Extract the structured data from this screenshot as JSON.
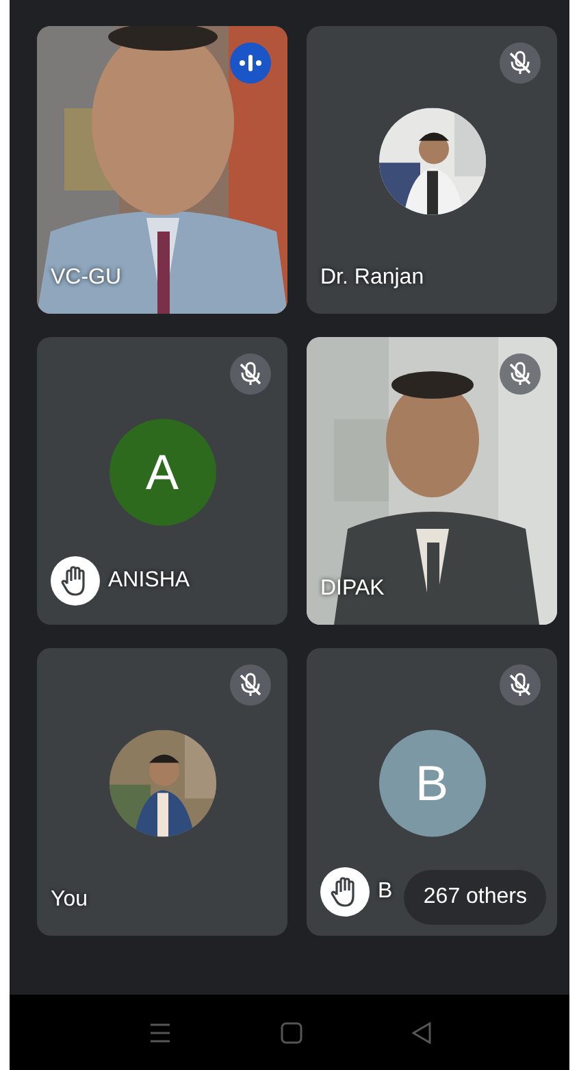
{
  "tiles": [
    {
      "kind": "video",
      "name": "VC-GU",
      "muted": false,
      "speaking": true,
      "hand_raised": false
    },
    {
      "name": "Dr. Ranjan",
      "muted": true,
      "speaking": false,
      "hand_raised": false
    },
    {
      "kind": "letter",
      "letter": "A",
      "color": "#2e6a1e",
      "name": "ANISHA",
      "muted": true,
      "speaking": false,
      "hand_raised": true
    },
    {
      "kind": "video",
      "name": "DIPAK",
      "muted": true,
      "speaking": false,
      "hand_raised": false
    },
    {
      "name": "You",
      "muted": true,
      "speaking": false,
      "hand_raised": false
    },
    {
      "kind": "letter",
      "letter": "B",
      "color": "#7b98a4",
      "name": "B",
      "muted": true,
      "speaking": false,
      "hand_raised": true
    }
  ],
  "overflow": {
    "label": "267 others"
  }
}
